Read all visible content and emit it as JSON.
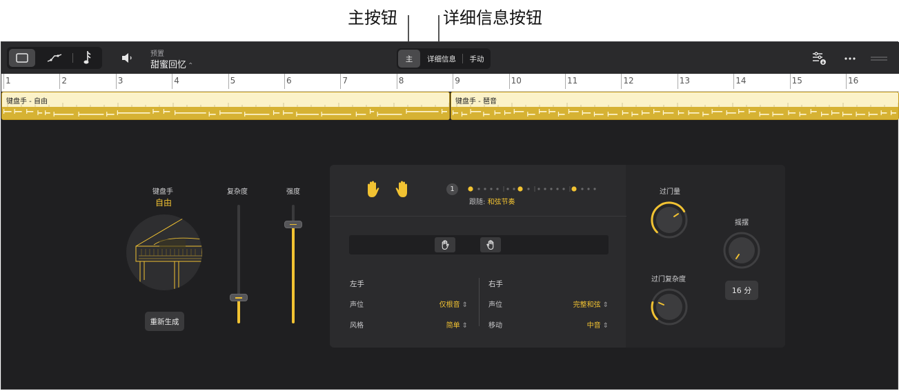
{
  "callouts": {
    "main_button": "主按钮",
    "details_button": "详细信息按钮"
  },
  "toolbar": {
    "preset_label": "预置",
    "preset_value": "甜蜜回忆",
    "modes": [
      "主",
      "详细信息",
      "手动"
    ],
    "active_mode": "主"
  },
  "ruler": {
    "bars": [
      "1",
      "2",
      "3",
      "4",
      "5",
      "6",
      "7",
      "8",
      "9",
      "10",
      "11",
      "12",
      "13",
      "14",
      "15",
      "16"
    ]
  },
  "regions": [
    {
      "label": "键盘手 - 自由"
    },
    {
      "label": "键盘手 - 琶音"
    }
  ],
  "performer": {
    "name": "键盘手",
    "style": "自由",
    "regenerate_label": "重新生成"
  },
  "sliders": {
    "complexity_label": "复杂度",
    "complexity_level": 0.22,
    "intensity_label": "强度",
    "intensity_level": 0.84
  },
  "pattern": {
    "step_number": "1",
    "follow_label": "跟随:",
    "follow_value": "和弦节奏"
  },
  "left_hand": {
    "title": "左手",
    "voicing_label": "声位",
    "voicing_value": "仅根音",
    "style_label": "风格",
    "style_value": "简单"
  },
  "right_hand": {
    "title": "右手",
    "voicing_label": "声位",
    "voicing_value": "完整和弦",
    "movement_label": "移动",
    "movement_value": "中音"
  },
  "knobs": {
    "fills_label": "过门量",
    "fill_complexity_label": "过门复杂度",
    "swing_label": "摇摆",
    "swing_value": "16 分"
  },
  "colors": {
    "accent": "#f1c232",
    "background": "#1f1f21",
    "region_fill": "#fbf2c8"
  }
}
